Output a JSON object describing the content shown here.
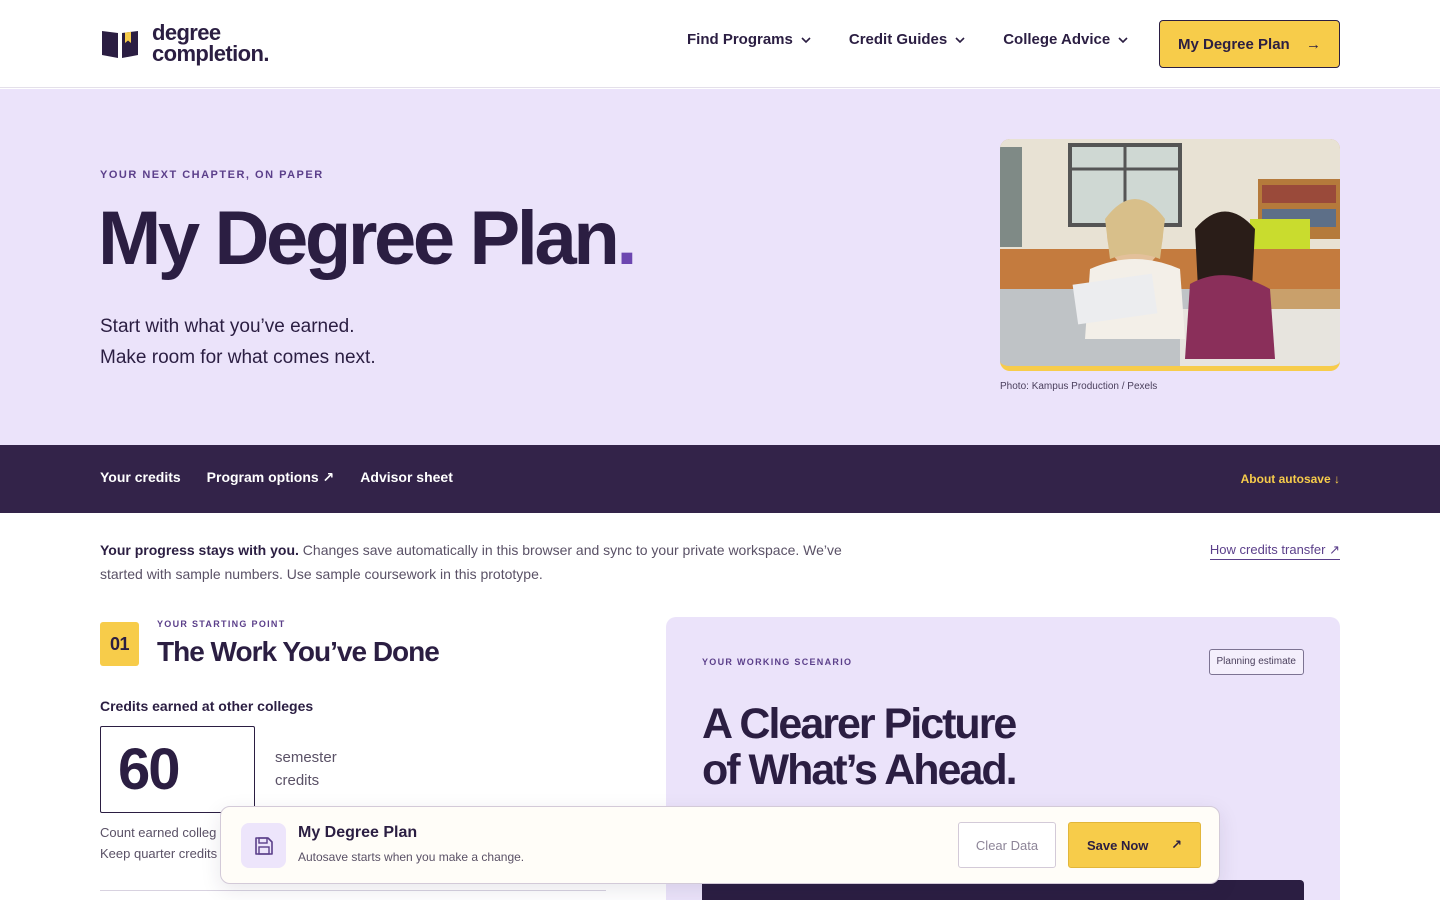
{
  "header": {
    "logo_line1": "degree",
    "logo_line2": "completion.",
    "nav": [
      {
        "label": "Find Programs"
      },
      {
        "label": "Credit Guides"
      },
      {
        "label": "College Advice"
      }
    ],
    "cta_label": "My Degree Plan",
    "cta_arrow": "→"
  },
  "hero": {
    "eyebrow": "YOUR NEXT CHAPTER, ON PAPER",
    "title": "My Degree Plan",
    "title_dot": ".",
    "subtitle_line1": "Start with what you’ve earned.",
    "subtitle_line2": "Make room for what comes next.",
    "photo_credit": "Photo: Kampus Production / Pexels"
  },
  "subnav": {
    "links": [
      {
        "label": "Your credits"
      },
      {
        "label": "Program options ↗"
      },
      {
        "label": "Advisor sheet"
      }
    ],
    "autosave_link": "About autosave ↓"
  },
  "intro": {
    "lead": "Your progress stays with you.",
    "body": " Changes save automatically in this browser and sync to your private workspace. We’ve started with sample numbers. Use sample coursework in this prototype.",
    "transfer_link": "How credits transfer ↗"
  },
  "step": {
    "number": "01",
    "eyebrow": "YOUR STARTING POINT",
    "title": "The Work You’ve Done",
    "field_label": "Credits earned at other colleges",
    "credits_value": "60",
    "unit_line1": "semester",
    "unit_line2": "credits",
    "help_line1": "Count earned colleg",
    "help_line2": "Keep quarter credits"
  },
  "scenario": {
    "eyebrow": "YOUR WORKING SCENARIO",
    "tag": "Planning estimate",
    "title_line1": "A Clearer Picture",
    "title_line2": "of What’s Ahead."
  },
  "toast": {
    "title": "My Degree Plan",
    "subtitle": "Autosave starts when you make a change.",
    "clear_label": "Clear Data",
    "save_label": "Save Now",
    "save_arrow": "↗"
  },
  "colors": {
    "brand_dark": "#2b1e42",
    "accent_yellow": "#f7cc4a",
    "lavender": "#ebe3fa",
    "purple": "#6c46b0"
  }
}
